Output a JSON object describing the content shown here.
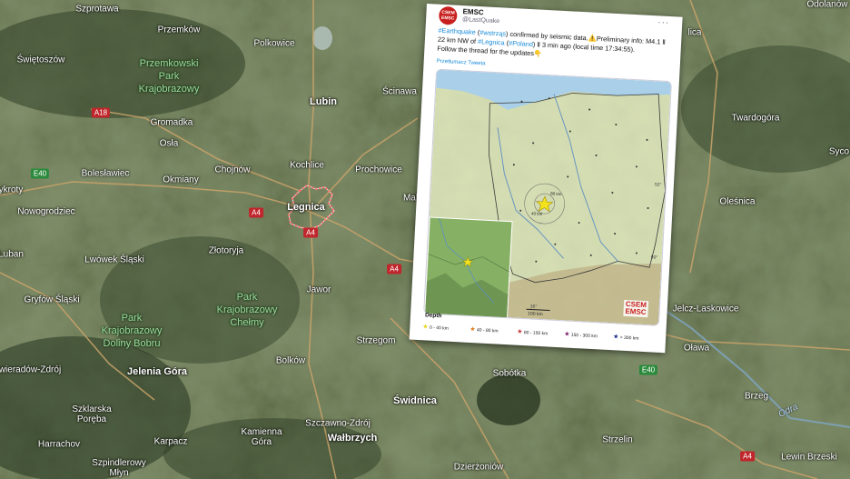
{
  "map": {
    "places": [
      {
        "name": "Szprotawa",
        "id": "szprotawa"
      },
      {
        "name": "Przemków",
        "id": "przemkow"
      },
      {
        "name": "Polkowice",
        "id": "polkowice"
      },
      {
        "name": "Świętoszów",
        "id": "swietoszow"
      },
      {
        "name": "Lubin",
        "id": "lubin",
        "big": true
      },
      {
        "name": "Ścinawa",
        "id": "scinawa"
      },
      {
        "name": "Gromadka",
        "id": "gromadka"
      },
      {
        "name": "Osła",
        "id": "osla"
      },
      {
        "name": "Kochlice",
        "id": "kochlice"
      },
      {
        "name": "Prochowice",
        "id": "prochowice"
      },
      {
        "name": "Bolesławiec",
        "id": "boleslawiec"
      },
      {
        "name": "Chojnów",
        "id": "chojnow"
      },
      {
        "name": "Okmiany",
        "id": "okmiany"
      },
      {
        "name": "Legnica",
        "id": "legnica",
        "big": true
      },
      {
        "name": "Malcz",
        "id": "malcz"
      },
      {
        "name": "Nowogrodziec",
        "id": "nowogrodziec"
      },
      {
        "name": "ykroty",
        "id": "ykroty"
      },
      {
        "name": "Złotoryja",
        "id": "zlotoryja"
      },
      {
        "name": "Luban",
        "id": "luban"
      },
      {
        "name": "Lwówek Śląski",
        "id": "lwowek"
      },
      {
        "name": "Jawor",
        "id": "jawor"
      },
      {
        "name": "Gryfów Śląski",
        "id": "gryfow"
      },
      {
        "name": "Strzegom",
        "id": "strzegom"
      },
      {
        "name": "Bolków",
        "id": "bolkow"
      },
      {
        "name": "wieradów-Zdrój",
        "id": "swieradow"
      },
      {
        "name": "Jelenia Góra",
        "id": "jelenia",
        "big": true
      },
      {
        "name": "Sobótka",
        "id": "sobotka"
      },
      {
        "name": "Świdnica",
        "id": "swidnica",
        "big": true
      },
      {
        "name": "Szklarska Poręba",
        "id": "szklarska"
      },
      {
        "name": "Szczawno-Zdrój",
        "id": "szczawno"
      },
      {
        "name": "Wałbrzych",
        "id": "walbrzych",
        "big": true
      },
      {
        "name": "Harrachov",
        "id": "harrachov"
      },
      {
        "name": "Karpacz",
        "id": "karpacz"
      },
      {
        "name": "Kamienna Góra",
        "id": "kamienna"
      },
      {
        "name": "Szpindlerowy Młyn",
        "id": "szpindlerowy"
      },
      {
        "name": "Strzelin",
        "id": "strzelin"
      },
      {
        "name": "Dzierżoniów",
        "id": "dzierzoniow"
      },
      {
        "name": "Odolanów",
        "id": "odolanow"
      },
      {
        "name": "Twardogóra",
        "id": "twardogora"
      },
      {
        "name": "Syco",
        "id": "syco"
      },
      {
        "name": "Oleśnica",
        "id": "olesnica"
      },
      {
        "name": "Jelcz-Laskowice",
        "id": "jelcz"
      },
      {
        "name": "Oława",
        "id": "olawa"
      },
      {
        "name": "Brzeg",
        "id": "brzeg"
      },
      {
        "name": "Lewin Brzeski",
        "id": "lewin"
      },
      {
        "name": "lica",
        "id": "lica"
      }
    ],
    "parks": [
      {
        "id": "park-przemkowski",
        "lines": [
          "Przemkowski",
          "Park",
          "Krajobrazowy"
        ]
      },
      {
        "id": "park-chelmy",
        "lines": [
          "Park",
          "Krajobrazowy",
          "Chełmy"
        ]
      },
      {
        "id": "park-bobru",
        "lines": [
          "Park",
          "Krajobrazowy",
          "Doliny Bobru"
        ]
      }
    ],
    "roads": [
      {
        "id": "a18",
        "label": "A18"
      },
      {
        "id": "e40-w",
        "label": "E40"
      },
      {
        "id": "a4-1",
        "label": "A4"
      },
      {
        "id": "a4-2",
        "label": "A4"
      },
      {
        "id": "a4-3",
        "label": "A4"
      },
      {
        "id": "e40-e",
        "label": "E40"
      },
      {
        "id": "a4-4",
        "label": "A4"
      }
    ],
    "river": "Odra"
  },
  "tweet": {
    "author_name": "EMSC",
    "author_handle": "@LastQuake",
    "avatar_text_1": "CSEM",
    "avatar_text_2": "EMSC",
    "more_label": "···",
    "text_parts": {
      "t1": "#Earthquake",
      "t2": " (",
      "t3": "#wstrząs",
      "t4": ") confirmed by seismic data.⚠️Preliminary info: M4.1 Ⅱ 22 km NW of ",
      "t5": "#Legnica",
      "t6": " (",
      "t7": "#Poland",
      "t8": ") Ⅱ 3 min ago (local time 17:34:55).",
      "t9": "Follow the thread for the updates👇"
    },
    "translate_label": "Przetłumacz Tweeta",
    "image": {
      "labels": {
        "radius80": "80 km",
        "radius40": "40 km",
        "deg52": "52°",
        "deg50": "50°",
        "deg16": "16°",
        "scale": "100 km",
        "logo1": "CSEM",
        "logo2": "EMSC"
      }
    },
    "legend": {
      "title": "Depth",
      "items": [
        {
          "label": "0 - 40 km",
          "color": "#e8d320"
        },
        {
          "label": "40 - 80 km",
          "color": "#e07a1f"
        },
        {
          "label": "80 - 150 km",
          "color": "#c43a3a"
        },
        {
          "label": "150 - 300 km",
          "color": "#7b1f6e"
        },
        {
          "label": "> 300 km",
          "color": "#1b2a8a"
        }
      ]
    }
  }
}
